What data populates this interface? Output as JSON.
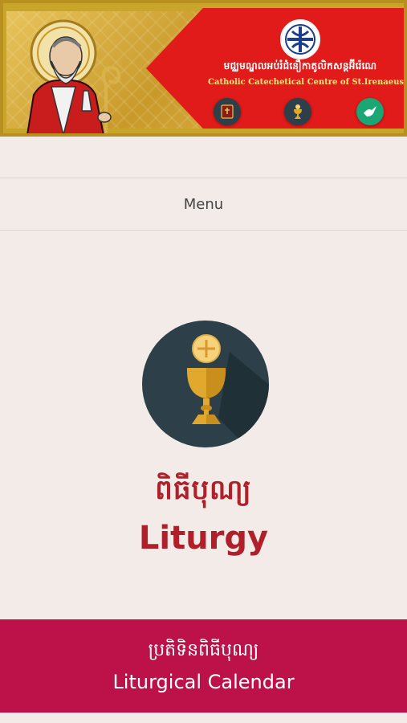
{
  "banner": {
    "title_km": "មជ្ឈមណ្ឌលអប់រំជំនឿកាតូលិកសន្តអ៊ីរ៉េណេ",
    "title_en": "Catholic Catechetical Centre of St.Irenaeus",
    "icons": [
      "bible-icon",
      "chalice-icon",
      "dove-icon"
    ]
  },
  "menu": {
    "label": "Menu"
  },
  "liturgy": {
    "icon": "chalice-host-icon",
    "title_km": "ពិធីបុណ្យ",
    "title_en": "Liturgy"
  },
  "calendar": {
    "title_km": "ប្រតិទិនពិធីបុណ្យ",
    "title_en": "Liturgical Calendar"
  },
  "colors": {
    "background": "#f2ebe8",
    "accent_red": "#b0202b",
    "calendar_bar": "#bc1249",
    "banner_red": "#e11a1a",
    "banner_gold": "#c9a52a",
    "icon_circle": "#2d3f48"
  }
}
